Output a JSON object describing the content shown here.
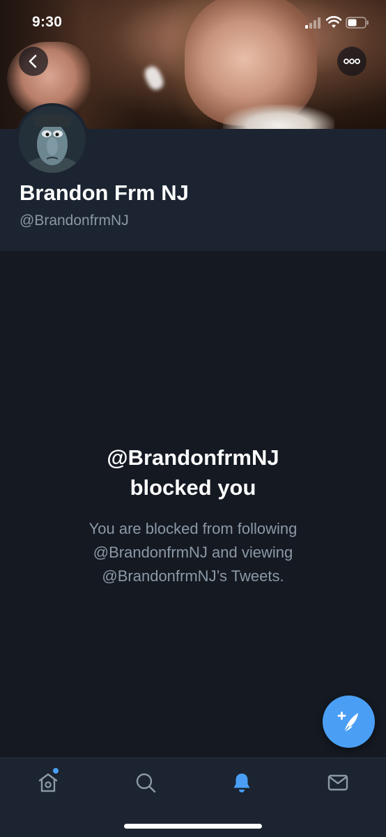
{
  "status_bar": {
    "time": "9:30"
  },
  "header": {
    "back_icon": "chevron-left-icon",
    "more_icon": "more-horizontal-icon"
  },
  "profile": {
    "display_name": "Brandon Frm NJ",
    "handle": "@BrandonfrmNJ"
  },
  "blocked": {
    "title_line1": "@BrandonfrmNJ",
    "title_line2": "blocked you",
    "desc_line1": "You are blocked from following",
    "desc_line2": "@BrandonfrmNJ and viewing",
    "desc_line3": "@BrandonfrmNJ’s Tweets."
  },
  "compose": {
    "icon": "compose-tweet-icon"
  },
  "tabs": [
    {
      "name": "home",
      "icon": "home-icon",
      "has_dot": true
    },
    {
      "name": "search",
      "icon": "search-icon"
    },
    {
      "name": "notifications",
      "icon": "bell-icon",
      "active": true
    },
    {
      "name": "messages",
      "icon": "mail-icon"
    }
  ],
  "colors": {
    "accent": "#4a9ff5",
    "background": "#141922",
    "panel": "#1b2430",
    "secondary_text": "#8c99a6"
  }
}
